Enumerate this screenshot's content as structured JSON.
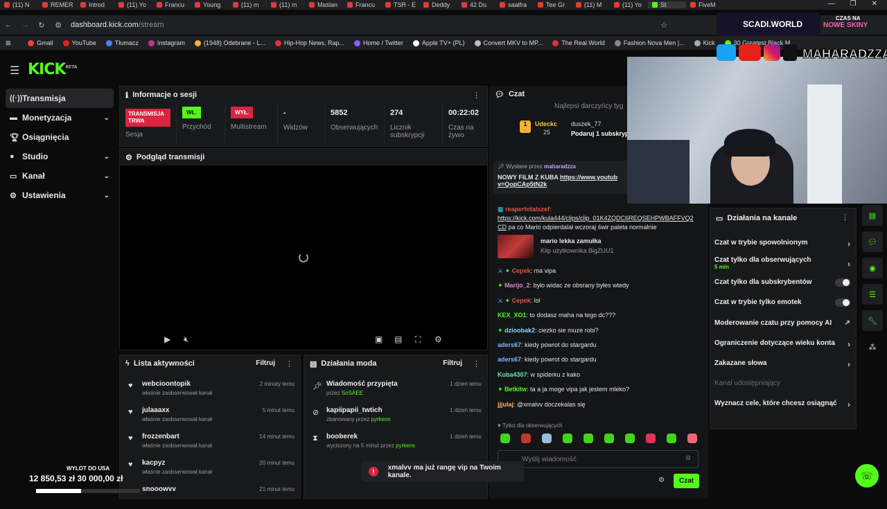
{
  "browser": {
    "tabs": [
      "(11) N",
      "REMER",
      "Introd",
      "(11) Yo",
      "Francu",
      "Young",
      "(11) m",
      "(11) m",
      "Maślan",
      "Francu",
      "TSR - E",
      "Deddy",
      "42 Du",
      "saalfra",
      "Tee Gr",
      "(11) M",
      "(11) Yo",
      "St",
      "FiveM"
    ],
    "url_host": "dashboard.kick.com",
    "url_path": "/stream",
    "bookmarks": [
      "Gmail",
      "YouTube",
      "Tłumacz",
      "Instagram",
      "(1948) Odebrane - L...",
      "Hip-Hop News, Rap...",
      "Home / Twitter",
      "Apple TV+ (PL)",
      "Convert MKV to MP...",
      "The Real World",
      "Fashion Nova Men |...",
      "Kick",
      "30 Greatest Black M..."
    ],
    "bookmarks_extra": "Wszystkie zakładki"
  },
  "kick": {
    "logo": "KICK",
    "logo_beta": "BETA"
  },
  "sidebar": {
    "items": [
      {
        "label": "Transmisja"
      },
      {
        "label": "Monetyzacja"
      },
      {
        "label": "Osiągnięcia"
      },
      {
        "label": "Studio"
      },
      {
        "label": "Kanał"
      },
      {
        "label": "Ustawienia"
      }
    ]
  },
  "session": {
    "title": "Informacje o sesji",
    "live_badge": "TRANSMISJA TRWA",
    "live_label": "Sesja",
    "on_badge": "WŁ.",
    "on_label": "Przychód twórcy",
    "off_badge": "WYŁ.",
    "off_label": "Multistream",
    "viewers_value": "-",
    "viewers_label": "Widzów",
    "followers_value": "5852",
    "followers_label": "Obserwujących",
    "subs_value": "274",
    "subs_label": "Licznik subskrypcji",
    "time_value": "00:22:02",
    "time_label": "Czas na żywo"
  },
  "preview": {
    "title": "Podgląd transmisji"
  },
  "activity": {
    "title": "Lista aktywności",
    "filter": "Filtruj",
    "items": [
      {
        "name": "webcioontopik",
        "sub": "właśnie zaobserwował kanał",
        "time": "2 minuty temu"
      },
      {
        "name": "julaaaxx",
        "sub": "właśnie zaobserwował kanał",
        "time": "5 minut temu"
      },
      {
        "name": "frozzenbart",
        "sub": "właśnie zaobserwował kanał",
        "time": "14 minut temu"
      },
      {
        "name": "kacpyz",
        "sub": "właśnie zaobserwował kanał",
        "time": "20 minut temu"
      },
      {
        "name": "snooowvv",
        "sub": "",
        "time": "21 minut temu"
      }
    ]
  },
  "modacts": {
    "title": "Działania moda",
    "filter": "Filtruj",
    "items": [
      {
        "name": "Wiadomość przypięta",
        "sub_prefix": "przez ",
        "sub_user": "SoSAEE",
        "sub_suffix": "",
        "time": "1 dzień temu"
      },
      {
        "name": "kapiipapii_twtich",
        "sub_prefix": "zbanowany przez ",
        "sub_user": "pyrkens",
        "sub_suffix": "",
        "time": "1 dzień temu"
      },
      {
        "name": "booberek",
        "sub_prefix": "wyciszony na 5 minut przez ",
        "sub_user": "pyrkens",
        "sub_suffix": "",
        "time": "1 dzień temu"
      }
    ]
  },
  "chat": {
    "title": "Czat",
    "top_gifters": "Najlepsi darczyńcy tyg",
    "gifter1": "Udeckc",
    "gifter1_count": "25",
    "gifter2": "duszek_77",
    "gifter2_action": "Podaruj 1 subskryp",
    "pinned_by_label": "Wysłane przez",
    "pinned_by": "maharadzza",
    "pinned_text": "NOWY FILM Z KUBA",
    "pinned_link": "https://www.youtub",
    "pinned_link2": "v=QopCAp5tN2k",
    "clip_user": "reapertotalszef:",
    "clip_link": "https://kick.com/kula444/clips/clip_01K4ZQDC6REQSEHPWBAFFVQ2",
    "clip_link2": "CD",
    "clip_msg": "pa co Mario odpierdalał wczoraj świr paleta normalnie",
    "clip_title": "mario lekka zamułka",
    "clip_sub": "Klip użytkownika BigZUU1",
    "messages": [
      {
        "user": "Cepek",
        "text": ": ma vipa",
        "color": "#e0524c"
      },
      {
        "user": "Marijo_2",
        "text": ": było widac ze obsrany byłes wtedy",
        "color": "#d48cd6"
      },
      {
        "user": "Cepek",
        "text": ": lol",
        "color": "#e0524c"
      },
      {
        "user": "KEX_XO1",
        "text": ": to dodasz maha na tego dc???",
        "color": "#53fc18"
      },
      {
        "user": "dzioobak2",
        "text": ": ciezko sie muze robi?",
        "color": "#8fd3ff"
      },
      {
        "user": "aders67",
        "text": ": kiedy powrot do stargardu",
        "color": "#7fb6ff"
      },
      {
        "user": "aders67",
        "text": ": kiedy powrot do stargardu",
        "color": "#7fb6ff"
      },
      {
        "user": "Kuba4307",
        "text": ": w spiderku z kako",
        "color": "#6ee7a8"
      },
      {
        "user": "Betkitw",
        "text": ": ta a ja moge vipa jak jestem mleko?",
        "color": "#53fc18"
      },
      {
        "user": "jjjulaj",
        "text": ": @xmalvv doczekalas się",
        "color": "#ffb36b"
      }
    ],
    "followers_only": "Tylko dla obserwujących",
    "input_placeholder": "Wyślij wiadomość",
    "send": "Czat"
  },
  "channel_actions": {
    "title": "Działania na kanale",
    "slow_mode": "Czat w trybie spowolnionym",
    "followers_only": "Czat tylko dla obserwujących",
    "followers_only_value": "5 min",
    "subs_only": "Czat tylko dla subskrybentów",
    "emotes_only": "Czat w trybie tylko emotek",
    "ai_moderation": "Moderowanie czatu przy pomocy AI",
    "age_restriction": "Ograniczenie dotyczące wieku konta",
    "banned_words": "Zakazane słowa",
    "shared_channel": "Kanał udostępniający",
    "goals": "Wyznacz cele, które chcesz osiągnąć"
  },
  "overlay": {
    "server": "SCADI.WORLD",
    "promo1": "CZAS NA",
    "promo2": "NOWE SKINY",
    "handle": "MAHARADZZA",
    "usa_label": "WYLOT DO USA",
    "usa_current": "12 850,53 zł",
    "usa_goal": "30 000,00 zł",
    "usa_progress": 0.43
  },
  "toast": {
    "text": "xmalvv ma już rangę vip na Twoim kanale."
  }
}
